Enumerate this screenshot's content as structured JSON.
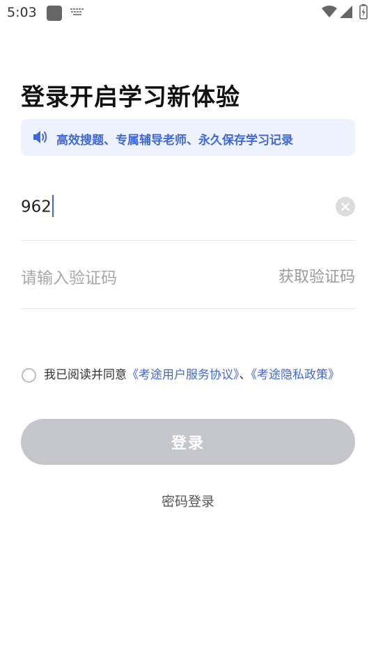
{
  "status_bar": {
    "time": "5:03"
  },
  "header": {
    "title": "登录开启学习新体验"
  },
  "notice": {
    "text": "高效搜题、专属辅导老师、永久保存学习记录"
  },
  "phone_field": {
    "value": "962"
  },
  "code_field": {
    "placeholder": "请输入验证码",
    "get_code_label": "获取验证码"
  },
  "agreement": {
    "prefix": "我已阅读并同意",
    "terms_link": "《考途用户服务协议》",
    "separator": "、",
    "privacy_link": "《考途隐私政策》"
  },
  "actions": {
    "login_label": "登录",
    "password_login_label": "密码登录"
  },
  "colors": {
    "accent": "#3f68d8",
    "notice_bg": "#eef2fc",
    "disabled_button": "#c5c6cb"
  }
}
